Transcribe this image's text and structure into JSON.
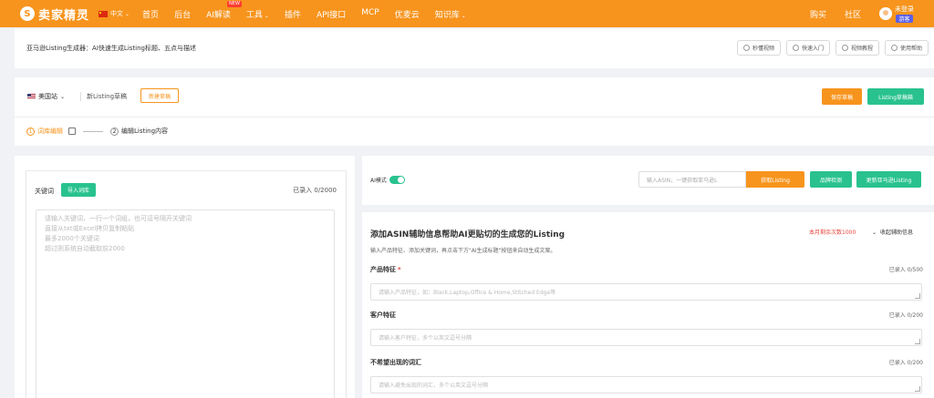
{
  "nav": {
    "logo_mark": "S",
    "logo_text": "卖家精灵",
    "lang": "中文",
    "items": [
      {
        "label": "首页",
        "caret": false,
        "badge": ""
      },
      {
        "label": "后台",
        "caret": false,
        "badge": ""
      },
      {
        "label": "AI解读",
        "caret": false,
        "badge": "NEW"
      },
      {
        "label": "工具",
        "caret": true,
        "badge": ""
      },
      {
        "label": "插件",
        "caret": false,
        "badge": ""
      },
      {
        "label": "API接口",
        "caret": false,
        "badge": ""
      },
      {
        "label": "MCP",
        "caret": false,
        "badge": ""
      },
      {
        "label": "优麦云",
        "caret": false,
        "badge": ""
      },
      {
        "label": "知识库",
        "caret": true,
        "badge": ""
      }
    ],
    "right": {
      "buy": "购买",
      "community": "社区",
      "user": "未登录",
      "guest": "游客"
    }
  },
  "title_bar": {
    "title": "亚马逊Listing生成器：AI快速生成Listing标题、五点与描述",
    "help_buttons": [
      "秒懂视频",
      "快速入门",
      "视频教程",
      "使用帮助"
    ]
  },
  "draft": {
    "site": "美国站",
    "draft_name": "新Listing草稿",
    "new_draft": "新建草稿",
    "save": "保存草稿",
    "draft_list": "Listing草稿箱",
    "step1": "词库编辑",
    "step2": "编辑Listing内容",
    "step1_num": "1",
    "step2_num": "2"
  },
  "keywords": {
    "label": "关键词",
    "import": "导入词库",
    "count": "已录入 0/2000",
    "placeholder_lines": [
      "请输入关键词，一行一个词组，也可逗号隔开关键词",
      "直接从txt或Excel拷贝复制粘贴",
      "最多2000个关键词",
      "超过则系统自动截取前2000"
    ]
  },
  "tools": {
    "ai_mode": "AI模式",
    "asin_placeholder": "输入ASIN，一键获取亚马逊L",
    "get_listing": "获取Listing",
    "brand_check": "品牌检测",
    "update_amazon": "更新亚马逊Listing"
  },
  "form": {
    "title": "添加ASIN辅助信息帮助AI更贴切的生成您的Listing",
    "subtitle": "输入产品特征、添加关键词，再点击下方\"AI生成标题\"按钮来自动生成文案。",
    "quota": "本月剩余次数1000",
    "collapse": "收起辅助信息",
    "fields": [
      {
        "label": "产品特征",
        "required": true,
        "count": "已录入 0/500",
        "placeholder": "请输入产品特征，如：Black,Laptop,Office & Home,Stitched Edge等"
      },
      {
        "label": "客户特征",
        "required": false,
        "count": "已录入 0/200",
        "placeholder": "请输入客户特征，多个以英文逗号分隔"
      },
      {
        "label": "不希望出现的词汇",
        "required": false,
        "count": "已录入 0/200",
        "placeholder": "请输入避免出现的词汇，多个以英文逗号分隔"
      }
    ]
  }
}
